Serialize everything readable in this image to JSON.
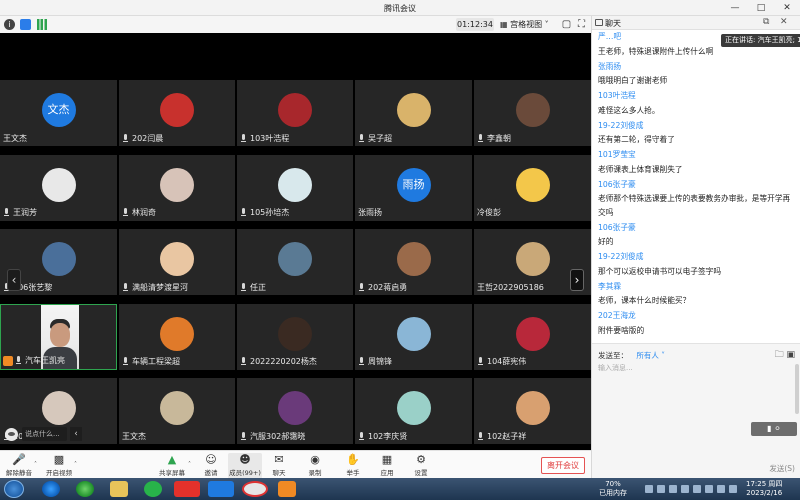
{
  "window": {
    "title": "腾讯会议"
  },
  "meeting_toolbar": {
    "timer": "01:12:34",
    "view_mode": "宫格视图"
  },
  "participants": [
    {
      "name": "王文杰",
      "avatar_text": "文杰",
      "avatar_color": "#1f7ae0",
      "muted_icon": false
    },
    {
      "name": "202闫晨",
      "avatar_color": "#c8312d",
      "muted_icon": true
    },
    {
      "name": "103叶浩程",
      "avatar_color": "#a8272c",
      "muted_icon": true
    },
    {
      "name": "吴子超",
      "avatar_color": "#d9b36a",
      "muted_icon": true
    },
    {
      "name": "李鑫朝",
      "avatar_color": "#6a4a3a",
      "muted_icon": true
    },
    {
      "name": "王润芳",
      "avatar_color": "#e8e8e8",
      "muted_icon": true
    },
    {
      "name": "林润奇",
      "avatar_color": "#d7c3b8",
      "muted_icon": true
    },
    {
      "name": "105孙培杰",
      "avatar_color": "#d8e8ec",
      "muted_icon": true
    },
    {
      "name": "张雨扬",
      "avatar_text": "雨扬",
      "avatar_color": "#1f7ae0",
      "muted_icon": false
    },
    {
      "name": "冷俊彭",
      "avatar_color": "#f3c74a",
      "muted_icon": false
    },
    {
      "name": "106张艺黎",
      "avatar_color": "#4a6f9a",
      "muted_icon": true
    },
    {
      "name": "满船清梦渡星河",
      "avatar_color": "#e9c6a2",
      "muted_icon": true
    },
    {
      "name": "任正",
      "avatar_color": "#5a7a94",
      "muted_icon": true
    },
    {
      "name": "202蒋启勇",
      "avatar_color": "#9a6a4a",
      "muted_icon": true
    },
    {
      "name": "王哲2022905186",
      "avatar_color": "#c9a878",
      "muted_icon": false
    },
    {
      "name": "汽车王凯亮",
      "avatar_color": "#ececec",
      "muted_icon": true,
      "active": true
    },
    {
      "name": "车辆工程梁超",
      "avatar_color": "#e07a2a",
      "muted_icon": true
    },
    {
      "name": "2022220202杨杰",
      "avatar_color": "#3a2a22",
      "muted_icon": true
    },
    {
      "name": "周锦锋",
      "avatar_color": "#8ab6d6",
      "muted_icon": true
    },
    {
      "name": "104薛宪伟",
      "avatar_color": "#b8283a",
      "muted_icon": true
    },
    {
      "name": "106李明哲",
      "avatar_color": "#d6c8bc",
      "muted_icon": true
    },
    {
      "name": "王文杰",
      "avatar_color": "#c8b89a",
      "muted_icon": false
    },
    {
      "name": "汽服302郝霭晓",
      "avatar_color": "#6a3a7a",
      "muted_icon": true
    },
    {
      "name": "102李庆贤",
      "avatar_color": "#9ad0c8",
      "muted_icon": true
    },
    {
      "name": "102赵子祥",
      "avatar_color": "#d8a070",
      "muted_icon": true
    }
  ],
  "chat_input": {
    "placeholder": "说点什么..."
  },
  "bottom_toolbar": {
    "mute": "解除静音",
    "video": "开启视频",
    "share": "共享屏幕",
    "invite": "邀请",
    "members": "成员(99+)",
    "chat": "聊天",
    "record": "录制",
    "raise_hand": "举手",
    "apps": "应用",
    "settings": "设置",
    "leave": "离开会议"
  },
  "chat_panel": {
    "title": "聊天",
    "speaking": "正在讲话: 汽车王凯亮; 10",
    "lines": [
      {
        "kind": "s",
        "text": "严…吧"
      },
      {
        "kind": "m",
        "text": "王老师，特殊退课附件上传什么啊"
      },
      {
        "kind": "s",
        "text": "张雨扬"
      },
      {
        "kind": "m",
        "text": "哦哦明白了谢谢老师"
      },
      {
        "kind": "s",
        "text": "103叶浩程"
      },
      {
        "kind": "m",
        "text": "难怪这么多人抢。"
      },
      {
        "kind": "s",
        "text": "19-22刘俊成"
      },
      {
        "kind": "m",
        "text": "还有第二轮，得守着了"
      },
      {
        "kind": "s",
        "text": "101罗莹宝"
      },
      {
        "kind": "m",
        "text": "老师课表上体育课削失了"
      },
      {
        "kind": "s",
        "text": "106张子豪"
      },
      {
        "kind": "m",
        "wrap": true,
        "text": "老师那个特殊选课要上传的表要教务办审批，是等开学再交吗"
      },
      {
        "kind": "s",
        "text": "106张子豪"
      },
      {
        "kind": "m",
        "text": "好的"
      },
      {
        "kind": "s",
        "text": "19-22刘俊成"
      },
      {
        "kind": "m",
        "text": "那个可以返校申请书可以电子签字吗"
      },
      {
        "kind": "s",
        "text": "李其霖"
      },
      {
        "kind": "m",
        "text": "老师，课本什么时候能买？"
      },
      {
        "kind": "s",
        "text": "202王海龙"
      },
      {
        "kind": "m",
        "text": "附件要啥版的"
      }
    ],
    "send_to_label": "发送至：",
    "send_to_value": "所有人 ˅",
    "input_placeholder": "输入消息...",
    "send": "发送(S)"
  },
  "taskbar": {
    "battery": "70%",
    "memory": "已用内存",
    "time": "17:25 周四",
    "date": "2023/2/16"
  }
}
